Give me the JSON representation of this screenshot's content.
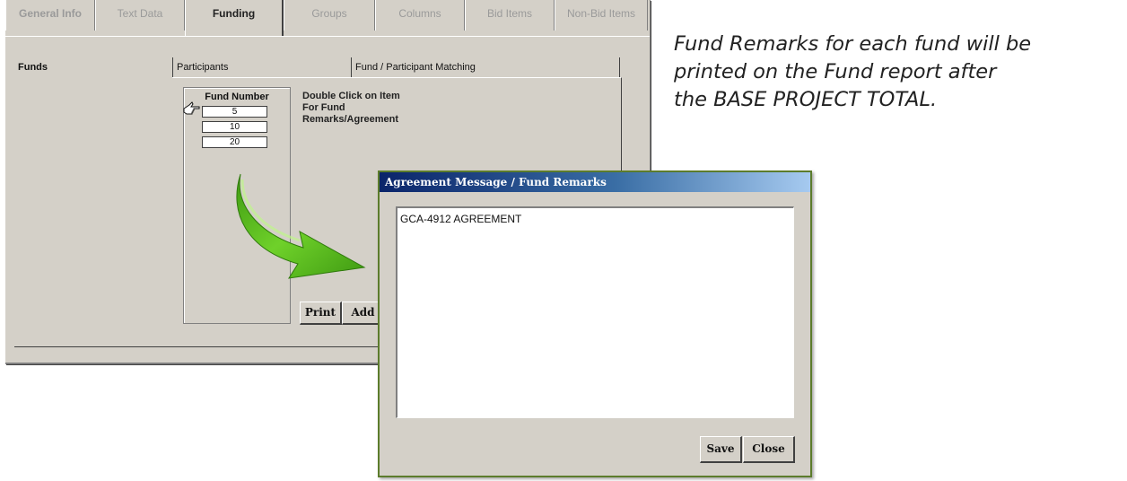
{
  "tabs": [
    {
      "label": "General Info"
    },
    {
      "label": "Text Data"
    },
    {
      "label": "Funding"
    },
    {
      "label": "Groups"
    },
    {
      "label": "Columns"
    },
    {
      "label": "Bid Items"
    },
    {
      "label": "Non-Bid Items"
    }
  ],
  "subtabs": [
    {
      "label": "Funds"
    },
    {
      "label": "Participants"
    },
    {
      "label": "Fund / Participant Matching"
    }
  ],
  "fund_list": {
    "header": "Fund Number",
    "rows": [
      "5",
      "10",
      "20"
    ]
  },
  "instructions": [
    "Double Click on Item",
    "For Fund",
    "Remarks/Agreement"
  ],
  "buttons": {
    "print": "Print",
    "add": "Add"
  },
  "dialog": {
    "title": "Agreement Message / Fund Remarks",
    "text": "GCA-4912 AGREEMENT",
    "save": "Save",
    "close": "Close"
  },
  "caption": [
    "Fund Remarks for each fund will be",
    "printed on the Fund report after",
    "the BASE PROJECT TOTAL."
  ],
  "colors": {
    "arrow": "#58b61a",
    "dialog_border": "#5c7c2c",
    "title_bar": "#0a246a"
  },
  "icons": {
    "pointer": "pointing-hand-icon",
    "arrow": "curved-arrow"
  }
}
